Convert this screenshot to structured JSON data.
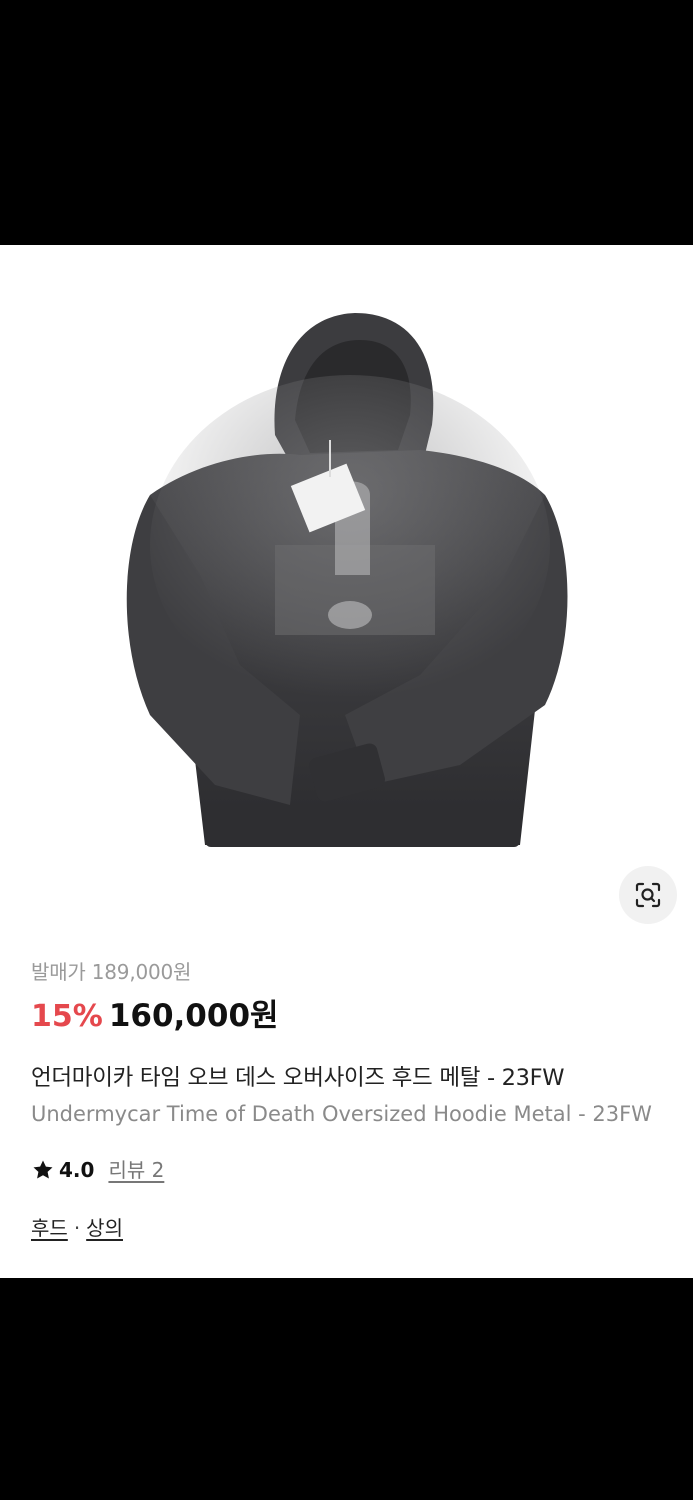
{
  "product": {
    "image_icon": "hoodie-image",
    "image_search_icon": "lens-icon",
    "retail_price_label": "발매가 189,000원",
    "discount": "15%",
    "price": "160,000원",
    "discount_color": "#e5484d",
    "name_ko": "언더마이카 타임 오브 데스 오버사이즈 후드 메탈 - 23FW",
    "name_en": "Undermycar Time of Death Oversized Hoodie Metal - 23FW",
    "rating": "4.0",
    "review_label": "리뷰 2",
    "categories": [
      "후드",
      "상의"
    ],
    "category_separator": "·"
  }
}
